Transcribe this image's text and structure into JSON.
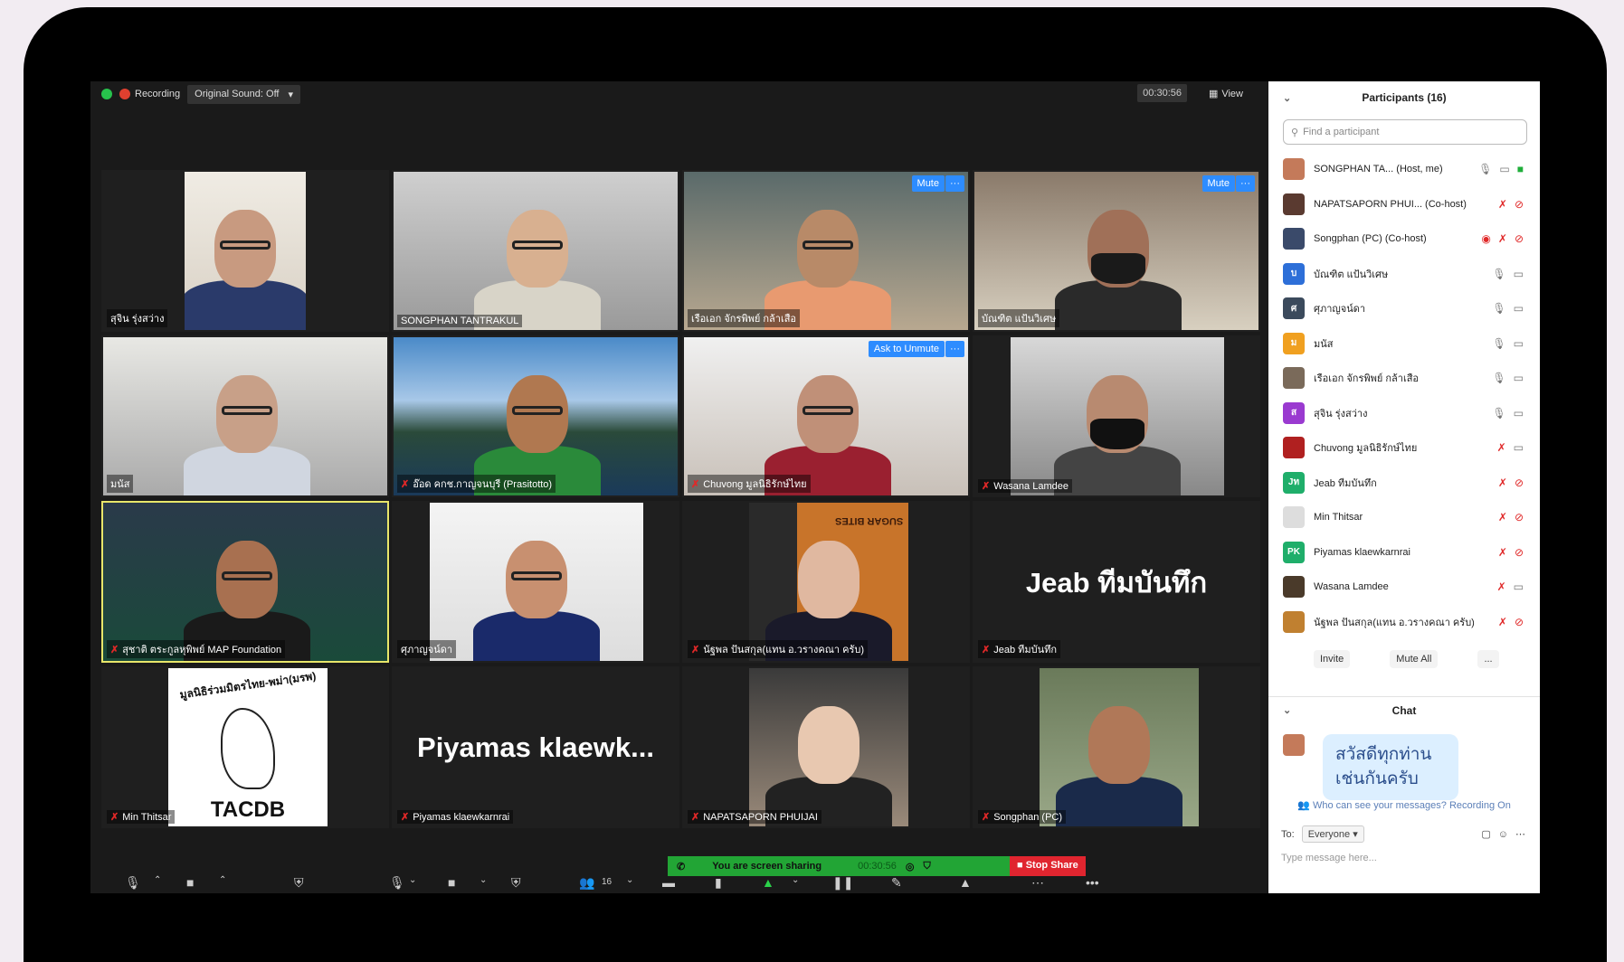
{
  "topbar": {
    "recording": "Recording",
    "original_sound": "Original Sound: Off",
    "timer": "00:30:56",
    "view": "View"
  },
  "tiles": [
    {
      "name": "สุจิน รุ่งสว่าง",
      "muted": false
    },
    {
      "name": "SONGPHAN TANTRAKUL",
      "muted": false
    },
    {
      "name": "เรือเอก จักรพิพย์ กล้าเสือ",
      "muted": false,
      "btn": "Mute"
    },
    {
      "name": "บัณฑิต แป้นวิเศษ",
      "muted": false,
      "btn": "Mute"
    },
    {
      "name": "มนัส",
      "muted": false
    },
    {
      "name": "อ๊อด คกช.กาญจนบุรี (Prasitotto)",
      "muted": true
    },
    {
      "name": "Chuvong  มูลนิธิรักษ์ไทย",
      "muted": true,
      "btn": "Ask to Unmute"
    },
    {
      "name": "Wasana Lamdee",
      "muted": true
    },
    {
      "name": "สุชาติ ตระกูลหุพิพย์ MAP Foundation",
      "muted": true
    },
    {
      "name": "ศุภาญจน์ดา",
      "muted": false
    },
    {
      "name": "นัฐพล ปันสกุล(แทน อ.วรางคณา ครับ)",
      "muted": true
    },
    {
      "name": "Jeab ทีมบันทึก",
      "muted": true,
      "big": "Jeab ทีมบันทึก"
    },
    {
      "name": "Min Thitsar",
      "muted": true,
      "logo": "TACDB",
      "logo_arc": "มูลนิธิร่วมมิตรไทย-พม่า(มรพ)"
    },
    {
      "name": "Piyamas klaewkarnrai",
      "muted": true,
      "big": "Piyamas  klaewk..."
    },
    {
      "name": "NAPATSAPORN PHUIJAI",
      "muted": true
    },
    {
      "name": "Songphan (PC)",
      "muted": true
    }
  ],
  "tile_sign": "SUGAR BITES",
  "sharing": {
    "text": "You are screen sharing",
    "time": "00:30:56",
    "stop": "Stop Share"
  },
  "toolbar": {
    "participants_count": "16"
  },
  "participants": {
    "title": "Participants (16)",
    "search_placeholder": "Find a participant",
    "list": [
      {
        "name": "SONGPHAN TA...  (Host, me)",
        "initial": "",
        "color": "#c47a5a"
      },
      {
        "name": "NAPATSAPORN PHUI... (Co-host)",
        "initial": "",
        "color": "#5a3a30"
      },
      {
        "name": "Songphan (PC) (Co-host)",
        "initial": "",
        "color": "#3a4a6a"
      },
      {
        "name": "บัณฑิต แป้นวิเศษ",
        "initial": "บ",
        "color": "#2d6fd8"
      },
      {
        "name": "ศุภาญจน์ดา",
        "initial": "ศ",
        "color": "#3b4a5c"
      },
      {
        "name": "มนัส",
        "initial": "ม",
        "color": "#f0a020"
      },
      {
        "name": "เรือเอก จักรพิพย์ กล้าเสือ",
        "initial": "",
        "color": "#7a6a5a"
      },
      {
        "name": "สุจิน รุ่งสว่าง",
        "initial": "ส",
        "color": "#9a3ad0"
      },
      {
        "name": "Chuvong  มูลนิธิรักษ์ไทย",
        "initial": "",
        "color": "#b02020"
      },
      {
        "name": "Jeab ทีมบันทึก",
        "initial": "Jท",
        "color": "#1fae6a"
      },
      {
        "name": "Min Thitsar",
        "initial": "",
        "color": "#dddddd"
      },
      {
        "name": "Piyamas klaewkarnrai",
        "initial": "PK",
        "color": "#1fae6a"
      },
      {
        "name": "Wasana Lamdee",
        "initial": "",
        "color": "#4a3a2a"
      },
      {
        "name": "นัฐพล ปันสกุล(แทน อ.วรางคณา ครับ)",
        "initial": "",
        "color": "#c08030"
      }
    ],
    "invite": "Invite",
    "mute_all": "Mute All",
    "more": "..."
  },
  "chat": {
    "title": "Chat",
    "message": "สวัสดีทุกท่าน เช่นกันครับ",
    "who_can_see": "Who can see your messages? Recording On",
    "to_label": "To:",
    "to_value": "Everyone",
    "placeholder": "Type message here..."
  }
}
